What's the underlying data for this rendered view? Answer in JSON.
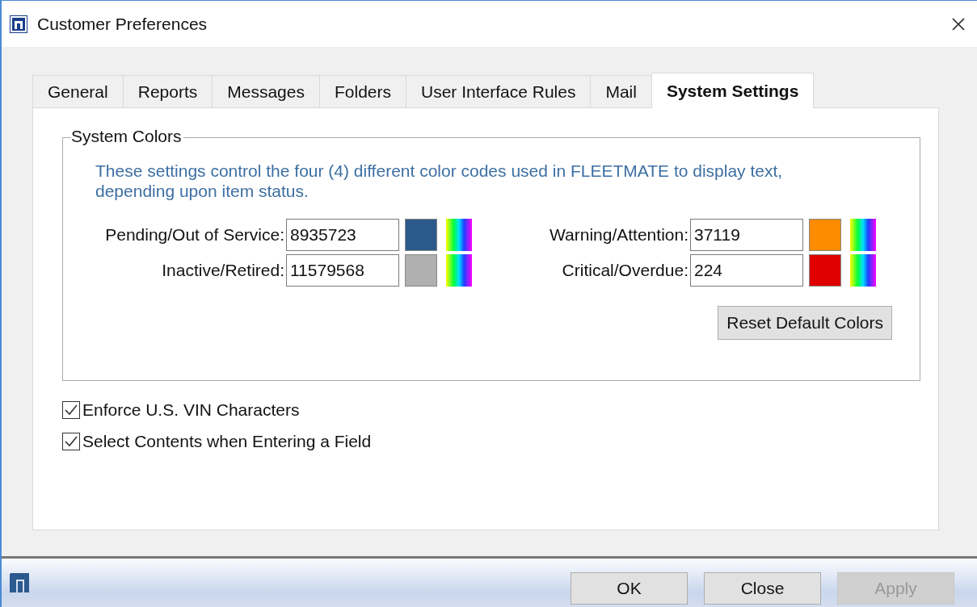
{
  "window": {
    "title": "Customer Preferences"
  },
  "tabs": [
    {
      "label": "General",
      "selected": false
    },
    {
      "label": "Reports",
      "selected": false
    },
    {
      "label": "Messages",
      "selected": false
    },
    {
      "label": "Folders",
      "selected": false
    },
    {
      "label": "User Interface Rules",
      "selected": false
    },
    {
      "label": "Mail",
      "selected": false
    },
    {
      "label": "System Settings",
      "selected": true
    }
  ],
  "system_colors": {
    "title": "System Colors",
    "description": "These settings control the four (4) different color codes used in FLEETMATE to display text, depending upon item status.",
    "items": [
      {
        "label": "Pending/Out of Service:",
        "value": "8935723",
        "color": "#2b5a8a"
      },
      {
        "label": "Warning/Attention:",
        "value": "37119",
        "color": "#ff8c00"
      },
      {
        "label": "Inactive/Retired:",
        "value": "11579568",
        "color": "#b0b0b0"
      },
      {
        "label": "Critical/Overdue:",
        "value": "224",
        "color": "#e00000"
      }
    ],
    "reset_button": "Reset Default Colors"
  },
  "checkboxes": [
    {
      "label": "Enforce U.S. VIN Characters",
      "checked": true
    },
    {
      "label": "Select Contents when Entering a Field",
      "checked": true
    }
  ],
  "buttons": [
    {
      "label": "OK",
      "disabled": false
    },
    {
      "label": "Close",
      "disabled": false
    },
    {
      "label": "Apply",
      "disabled": true
    }
  ]
}
